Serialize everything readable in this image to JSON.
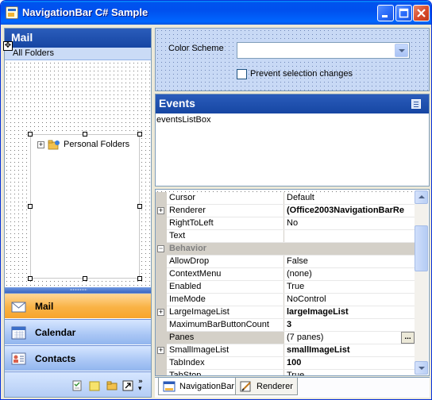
{
  "window": {
    "title": "NavigationBar C# Sample"
  },
  "nav": {
    "header": "Mail",
    "subheader": "All Folders",
    "tree_item": "Personal Folders",
    "buttons": [
      {
        "label": "Mail",
        "icon": "mail-icon",
        "active": true
      },
      {
        "label": "Calendar",
        "icon": "calendar-icon",
        "active": false
      },
      {
        "label": "Contacts",
        "icon": "contacts-icon",
        "active": false
      }
    ],
    "footer_icons": [
      "tasks-icon",
      "notes-icon",
      "folder-icon",
      "shortcut-icon",
      "overflow-chevron-icon"
    ]
  },
  "color_scheme": {
    "label": "Color Scheme",
    "value": "",
    "checkbox_label": "Prevent selection changes",
    "checked": false
  },
  "events": {
    "header": "Events",
    "list_text": "eventsListBox"
  },
  "properties": {
    "rows": [
      {
        "name": "Cursor",
        "value": "Default",
        "expandable": false,
        "bold": false
      },
      {
        "name": "Renderer",
        "value": "(Office2003NavigationBarRe",
        "expandable": true,
        "bold": true
      },
      {
        "name": "RightToLeft",
        "value": "No",
        "expandable": false,
        "bold": false
      },
      {
        "name": "Text",
        "value": "",
        "expandable": false,
        "bold": false
      },
      {
        "category": "Behavior"
      },
      {
        "name": "AllowDrop",
        "value": "False",
        "expandable": false,
        "bold": false
      },
      {
        "name": "ContextMenu",
        "value": "(none)",
        "expandable": false,
        "bold": false
      },
      {
        "name": "Enabled",
        "value": "True",
        "expandable": false,
        "bold": false
      },
      {
        "name": "ImeMode",
        "value": "NoControl",
        "expandable": false,
        "bold": false
      },
      {
        "name": "LargeImageList",
        "value": "largeImageList",
        "expandable": true,
        "bold": true
      },
      {
        "name": "MaximumBarButtonCount",
        "value": "3",
        "expandable": false,
        "bold": true
      },
      {
        "name": "Panes",
        "value": "(7 panes)",
        "expandable": false,
        "bold": false,
        "selected": true,
        "ellipsis": "..."
      },
      {
        "name": "SmallImageList",
        "value": "smallImageList",
        "expandable": true,
        "bold": true
      },
      {
        "name": "TabIndex",
        "value": "100",
        "expandable": false,
        "bold": true
      },
      {
        "name": "TabStop",
        "value": "True",
        "expandable": false,
        "bold": false
      }
    ]
  },
  "tabs": [
    {
      "label": "NavigationBar",
      "active": true
    },
    {
      "label": "Renderer",
      "active": false
    }
  ]
}
